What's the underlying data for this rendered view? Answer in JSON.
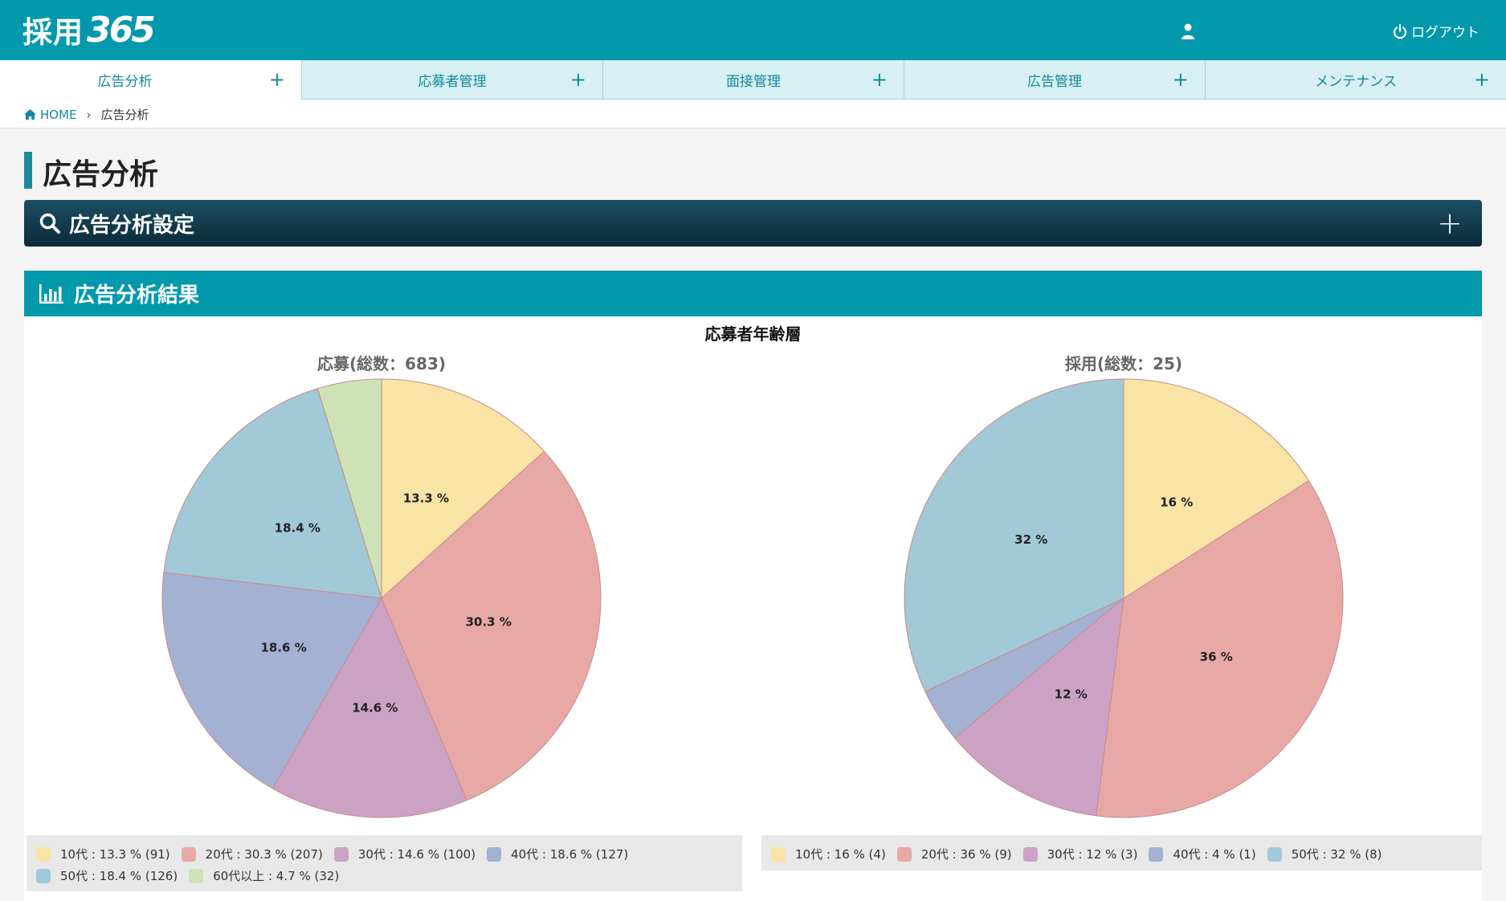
{
  "header": {
    "logo_kanji": "採用",
    "logo_number": "365",
    "user_icon": "user-icon",
    "logout_label": "ログアウト",
    "logout_icon": "power-icon"
  },
  "tabs": [
    {
      "label": "広告分析",
      "active": true
    },
    {
      "label": "応募者管理",
      "active": false
    },
    {
      "label": "面接管理",
      "active": false
    },
    {
      "label": "広告管理",
      "active": false
    },
    {
      "label": "メンテナンス",
      "active": false
    }
  ],
  "breadcrumb": {
    "home": "HOME",
    "separator": "›",
    "current": "広告分析"
  },
  "page_title": "広告分析",
  "settings_panel": {
    "label": "広告分析設定",
    "toggle": "+"
  },
  "result_panel": {
    "label": "広告分析結果"
  },
  "chart_data": [
    {
      "type": "pie",
      "title": "応募者年齢層",
      "subtitle": "応募(総数：683)",
      "slices": [
        {
          "label": "10代",
          "percent": 13.3,
          "count": 91,
          "color": "#f9e3a5",
          "label_text": "13.3 %",
          "legend_text": "10代 : 13.3 % (91)"
        },
        {
          "label": "20代",
          "percent": 30.3,
          "count": 207,
          "color": "#e8a8a6",
          "label_text": "30.3 %",
          "legend_text": "20代 : 30.3 % (207)"
        },
        {
          "label": "30代",
          "percent": 14.6,
          "count": 100,
          "color": "#cca2c4",
          "label_text": "14.6 %",
          "legend_text": "30代 : 14.6 % (100)"
        },
        {
          "label": "40代",
          "percent": 18.6,
          "count": 127,
          "color": "#a3b1d3",
          "label_text": "18.6 %",
          "legend_text": "40代 : 18.6 % (127)"
        },
        {
          "label": "50代",
          "percent": 18.4,
          "count": 126,
          "color": "#a1c9d7",
          "label_text": "18.4 %",
          "legend_text": "50代 : 18.4 % (126)"
        },
        {
          "label": "60代以上",
          "percent": 4.7,
          "count": 32,
          "color": "#cde3b6",
          "label_text": "",
          "legend_text": "60代以上 : 4.7 % (32)"
        }
      ]
    },
    {
      "type": "pie",
      "title": "応募者年齢層",
      "subtitle": "採用(総数：25)",
      "slices": [
        {
          "label": "10代",
          "percent": 16,
          "count": 4,
          "color": "#f9e3a5",
          "label_text": "16 %",
          "legend_text": "10代 : 16 % (4)"
        },
        {
          "label": "20代",
          "percent": 36,
          "count": 9,
          "color": "#e8a8a6",
          "label_text": "36 %",
          "legend_text": "20代 : 36 % (9)"
        },
        {
          "label": "30代",
          "percent": 12,
          "count": 3,
          "color": "#cca2c4",
          "label_text": "12 %",
          "legend_text": "30代 : 12 % (3)"
        },
        {
          "label": "40代",
          "percent": 4,
          "count": 1,
          "color": "#a3b1d3",
          "label_text": "",
          "legend_text": "40代 : 4 % (1)"
        },
        {
          "label": "50代",
          "percent": 32,
          "count": 8,
          "color": "#a1c9d7",
          "label_text": "32 %",
          "legend_text": "50代 : 32 % (8)"
        }
      ]
    }
  ],
  "colors": {
    "brand": "#0399ad",
    "tab_bg": "#d8f0f3",
    "settings_dark": "#0b2a38",
    "legend_bg": "#e8e8e8"
  }
}
